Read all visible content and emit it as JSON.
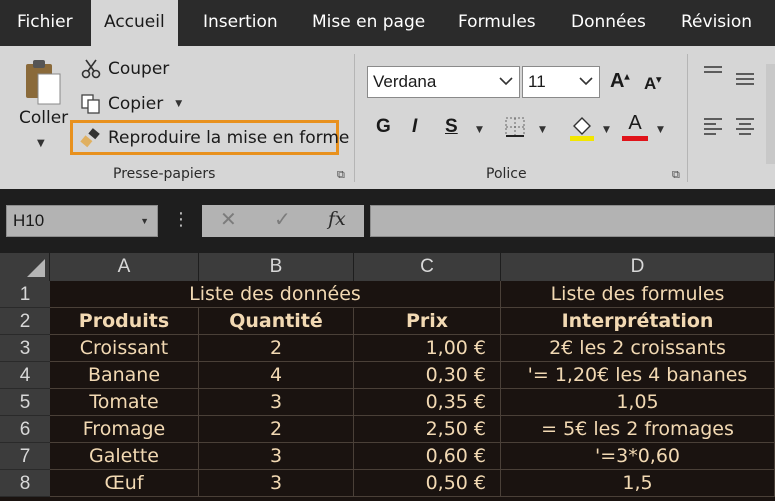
{
  "tabs": [
    "Fichier",
    "Accueil",
    "Insertion",
    "Mise en page",
    "Formules",
    "Données",
    "Révision"
  ],
  "active_tab": "Accueil",
  "clipboard": {
    "paste_label": "Coller",
    "cut_label": "Couper",
    "copy_label": "Copier",
    "format_painter_label": "Reproduire la mise en forme",
    "group_label": "Presse-papiers"
  },
  "font": {
    "family": "Verdana",
    "size": "11",
    "bold_label": "G",
    "italic_label": "I",
    "underline_label": "S",
    "grow_label": "A",
    "shrink_label": "A",
    "fill_color": "#f2e600",
    "font_color": "#e0131a",
    "font_color_label": "A",
    "group_label": "Police"
  },
  "formula_bar": {
    "name_box": "H10",
    "cancel_icon": "✕",
    "enter_icon": "✓",
    "fx_label": "fx",
    "content": ""
  },
  "sheet": {
    "columns": [
      "A",
      "B",
      "C",
      "D"
    ],
    "rows": [
      "1",
      "2",
      "3",
      "4",
      "5",
      "6",
      "7",
      "8"
    ],
    "title_left": "Liste des données",
    "title_right": "Liste des formules",
    "headers": [
      "Produits",
      "Quantité",
      "Prix",
      "Interprétation"
    ],
    "data": [
      [
        "Croissant",
        "2",
        "1,00 €",
        "2€ les 2 croissants"
      ],
      [
        "Banane",
        "4",
        "0,30 €",
        "'= 1,20€ les 4 bananes"
      ],
      [
        "Tomate",
        "3",
        "0,35 €",
        "1,05"
      ],
      [
        "Fromage",
        "2",
        "2,50 €",
        "= 5€ les 2 fromages"
      ],
      [
        "Galette",
        "3",
        "0,60 €",
        "'=3*0,60"
      ],
      [
        "Œuf",
        "3",
        "0,50 €",
        "1,5"
      ]
    ],
    "cell_text_color": "#f2d9b3",
    "cell_bg_color": "#1a1310"
  },
  "accent_color": "#e8911e"
}
